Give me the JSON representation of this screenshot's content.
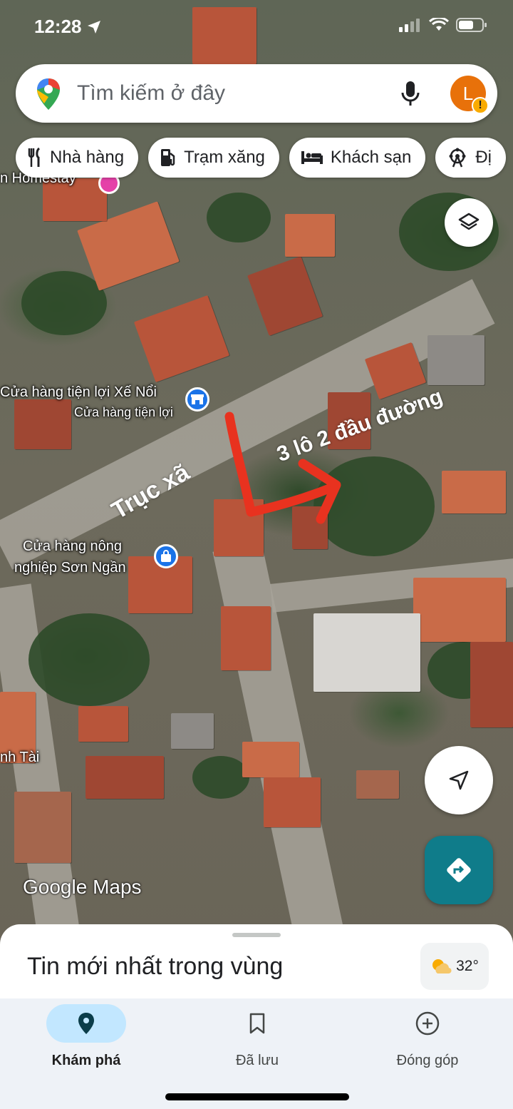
{
  "status_bar": {
    "time": "12:28"
  },
  "search": {
    "placeholder": "Tìm kiếm ở đây",
    "avatar_letter": "L",
    "warning_glyph": "!"
  },
  "chips": [
    {
      "label": "Nhà hàng",
      "icon": "restaurant-icon"
    },
    {
      "label": "Trạm xăng",
      "icon": "gas-station-icon"
    },
    {
      "label": "Khách sạn",
      "icon": "hotel-icon"
    },
    {
      "label": "Đị",
      "icon": "attractions-icon"
    }
  ],
  "map": {
    "labels": {
      "homestay": "n Homestay",
      "store_name": "Cửa hàng tiện lợi Xế Nổi",
      "store_category": "Cửa hàng tiện lợi",
      "agri_line1": "Cửa hàng nông",
      "agri_line2": "nghiệp Sơn Ngần",
      "tai": "nh Tài"
    },
    "overlay_texts": {
      "road": "Trục xã",
      "lots": "3 lô 2 đầu đường"
    },
    "watermark": "Google Maps",
    "arrow_color": "#e8321f"
  },
  "sheet": {
    "title": "Tin mới nhất trong vùng",
    "temperature": "32°"
  },
  "nav": {
    "explore": "Khám phá",
    "saved": "Đã lưu",
    "contribute": "Đóng góp"
  },
  "colors": {
    "accent": "#0f7c8a",
    "nav_active_pill": "#c2e7ff",
    "avatar": "#e8710a"
  }
}
